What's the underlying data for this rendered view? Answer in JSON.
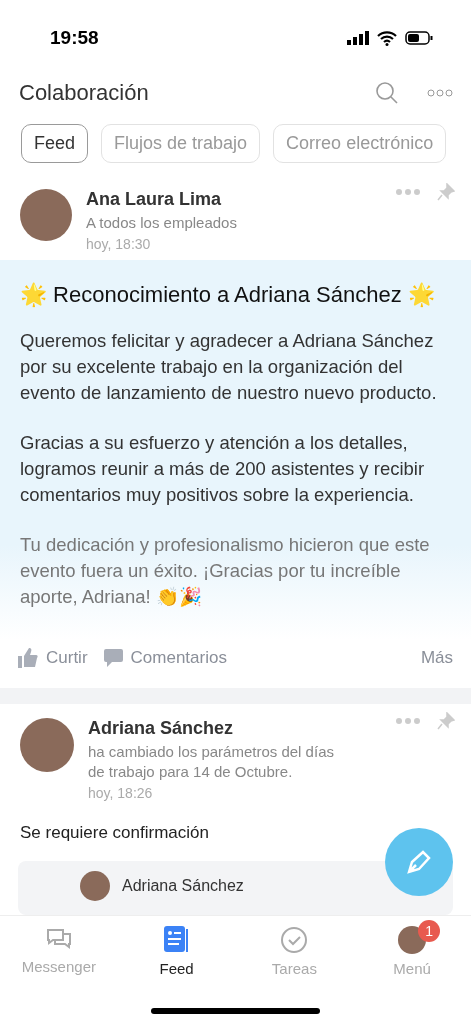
{
  "status_bar": {
    "time": "19:58"
  },
  "header": {
    "title": "Colaboración"
  },
  "tabs": [
    {
      "label": "Feed",
      "selected": true
    },
    {
      "label": "Flujos de trabajo",
      "selected": false
    },
    {
      "label": "Correo electrónico",
      "selected": false
    }
  ],
  "posts": [
    {
      "author": "Ana Laura Lima",
      "subtitle": "A todos los empleados",
      "time": "hoy, 18:30",
      "title": "🌟 Reconocimiento a Adriana Sánchez 🌟",
      "paragraphs": [
        "Queremos felicitar y agradecer a Adriana Sánchez por su excelente trabajo en la organización del evento de lanzamiento de nuestro nuevo producto.",
        "Gracias a su esfuerzo y atención a los detalles, logramos reunir a más de 200 asistentes y recibir comentarios muy positivos sobre la experiencia.",
        "Tu dedicación y profesionalismo hicieron que este evento fuera un éxito. ¡Gracias por tu increíble aporte, Adriana! 👏🎉"
      ],
      "actions": [
        "Curtir",
        "Comentarios",
        "Más"
      ]
    },
    {
      "author": "Adriana Sánchez",
      "subtitle": "ha cambiado los parámetros del días de trabajo para 14 de Octubre.",
      "time": "hoy, 18:26",
      "note": "Se requiere confirmación",
      "card_author": "Adriana Sánchez"
    }
  ],
  "nav": [
    {
      "label": "Messenger",
      "selected": false,
      "kind": "chat"
    },
    {
      "label": "Feed",
      "selected": true,
      "kind": "feed"
    },
    {
      "label": "Tareas",
      "selected": false,
      "kind": "tasks"
    },
    {
      "label": "Menú",
      "selected": false,
      "kind": "avatar",
      "badge": "1"
    }
  ]
}
